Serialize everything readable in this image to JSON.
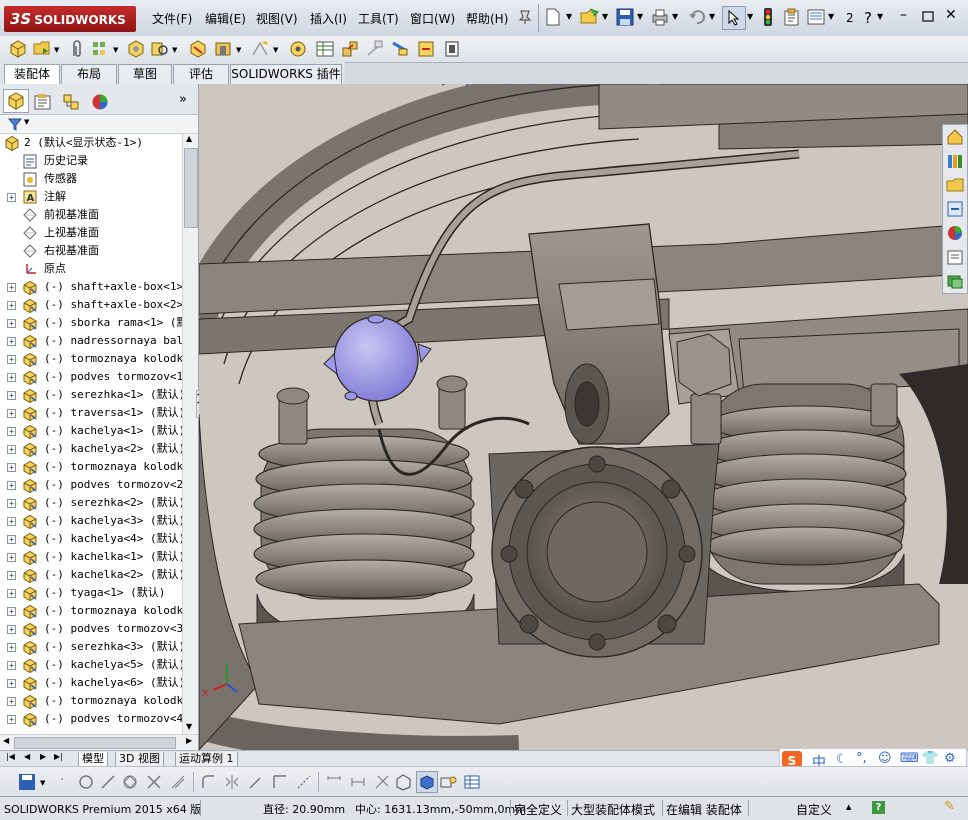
{
  "app": {
    "logo": "SOLIDWORKS",
    "logo_prefix": "3S",
    "brand_color": "#b41f1f"
  },
  "menu": [
    {
      "label": "文件(F)"
    },
    {
      "label": "编辑(E)"
    },
    {
      "label": "视图(V)"
    },
    {
      "label": "插入(I)"
    },
    {
      "label": "工具(T)"
    },
    {
      "label": "窗口(W)"
    },
    {
      "label": "帮助(H)"
    }
  ],
  "title_toolbar": {
    "window_index": "2",
    "help": "?"
  },
  "command_tabs": [
    {
      "label": "装配体",
      "active": true
    },
    {
      "label": "布局"
    },
    {
      "label": "草图"
    },
    {
      "label": "评估"
    },
    {
      "label": "SOLIDWORKS 插件"
    }
  ],
  "feature_tree": {
    "root": "2  (默认<显示状态-1>)",
    "items": [
      {
        "label": "历史记录",
        "icon": "history-icon",
        "expand": false
      },
      {
        "label": "传感器",
        "icon": "sensor-icon",
        "expand": false
      },
      {
        "label": "注解",
        "icon": "annotation-icon",
        "expand": true
      },
      {
        "label": "前视基准面",
        "icon": "plane-icon",
        "expand": false
      },
      {
        "label": "上视基准面",
        "icon": "plane-icon",
        "expand": false
      },
      {
        "label": "右视基准面",
        "icon": "plane-icon",
        "expand": false
      },
      {
        "label": "原点",
        "icon": "origin-icon",
        "expand": false
      },
      {
        "label": "(-) shaft+axle-box<1> (",
        "icon": "part-icon",
        "expand": true
      },
      {
        "label": "(-) shaft+axle-box<2> (",
        "icon": "part-icon",
        "expand": true
      },
      {
        "label": "(-) sborka rama<1> (默认",
        "icon": "part-icon",
        "expand": true
      },
      {
        "label": "(-) nadressornaya balka",
        "icon": "part-icon",
        "expand": true
      },
      {
        "label": "(-) tormoznaya kolodka<",
        "icon": "part-icon",
        "expand": true
      },
      {
        "label": "(-) podves tormozov<1>",
        "icon": "part-icon",
        "expand": true
      },
      {
        "label": "(-) serezhka<1> (默认)",
        "icon": "part-icon",
        "expand": true
      },
      {
        "label": "(-) traversa<1> (默认)",
        "icon": "part-icon",
        "expand": true
      },
      {
        "label": "(-) kachelya<1> (默认)",
        "icon": "part-icon",
        "expand": true
      },
      {
        "label": "(-) kachelya<2> (默认)",
        "icon": "part-icon",
        "expand": true
      },
      {
        "label": "(-) tormoznaya kolodka<",
        "icon": "part-icon",
        "expand": true
      },
      {
        "label": "(-) podves tormozov<2>",
        "icon": "part-icon",
        "expand": true
      },
      {
        "label": "(-) serezhka<2> (默认)",
        "icon": "part-icon",
        "expand": true
      },
      {
        "label": "(-) kachelya<3> (默认)",
        "icon": "part-icon",
        "expand": true
      },
      {
        "label": "(-) kachelya<4> (默认)",
        "icon": "part-icon",
        "expand": true
      },
      {
        "label": "(-) kachelka<1> (默认)",
        "icon": "part-icon",
        "expand": true
      },
      {
        "label": "(-) kachelka<2> (默认)",
        "icon": "part-icon",
        "expand": true
      },
      {
        "label": "(-) tyaga<1> (默认)",
        "icon": "part-icon",
        "expand": true
      },
      {
        "label": "(-) tormoznaya kolodka<",
        "icon": "part-icon",
        "expand": true
      },
      {
        "label": "(-) podves tormozov<3>",
        "icon": "part-icon",
        "expand": true
      },
      {
        "label": "(-) serezhka<3> (默认)",
        "icon": "part-icon",
        "expand": true
      },
      {
        "label": "(-) kachelya<5> (默认)",
        "icon": "part-icon",
        "expand": true
      },
      {
        "label": "(-) kachelya<6> (默认)",
        "icon": "part-icon",
        "expand": true
      },
      {
        "label": "(-) tormoznaya kolodka<",
        "icon": "part-icon",
        "expand": true
      },
      {
        "label": "(-) podves tormozov<4>",
        "icon": "part-icon",
        "expand": true
      }
    ]
  },
  "bottom_tabs": [
    {
      "label": "模型",
      "active": true
    },
    {
      "label": "3D 视图"
    },
    {
      "label": "运动算例 1"
    }
  ],
  "status": {
    "product": "SOLIDWORKS Premium 2015 x64 版",
    "diameter": "直径: 20.90mm",
    "center": "中心: 1631.13mm,-50mm,0mm",
    "definition": "完全定义",
    "mode": "大型装配体模式",
    "editing": "在编辑 装配体",
    "units": "自定义"
  },
  "ime": {
    "label": "中"
  },
  "colors": {
    "model_body": "#8e8780",
    "model_edge": "#2b2723",
    "selected_part": "#9d98e8",
    "viewport_bg": "#cfc9c2"
  }
}
